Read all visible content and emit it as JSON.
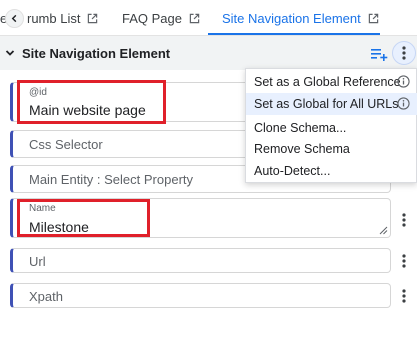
{
  "tabs": [
    {
      "label": "e"
    },
    {
      "label": "rumb List"
    },
    {
      "label": "FAQ Page"
    },
    {
      "label": "Site Navigation Element"
    }
  ],
  "section": {
    "title": "Site Navigation Element"
  },
  "fields": {
    "id_label": "@id",
    "id_value": "Main website page",
    "css_selector": "Css Selector",
    "main_entity": "Main Entity : Select Property",
    "name_label": "Name",
    "name_value": "Milestone",
    "url": "Url",
    "xpath": "Xpath"
  },
  "menu": {
    "items": [
      {
        "label": "Set as a Global Reference"
      },
      {
        "label": "Set as Global for All URLs"
      },
      {
        "label": "Clone Schema..."
      },
      {
        "label": "Remove Schema"
      },
      {
        "label": "Auto-Detect..."
      }
    ]
  },
  "colors": {
    "accent": "#1a73e8",
    "field_border_left": "#3f51b5",
    "highlight_box": "#e0202a",
    "menu_hover": "#e8f0fe"
  }
}
